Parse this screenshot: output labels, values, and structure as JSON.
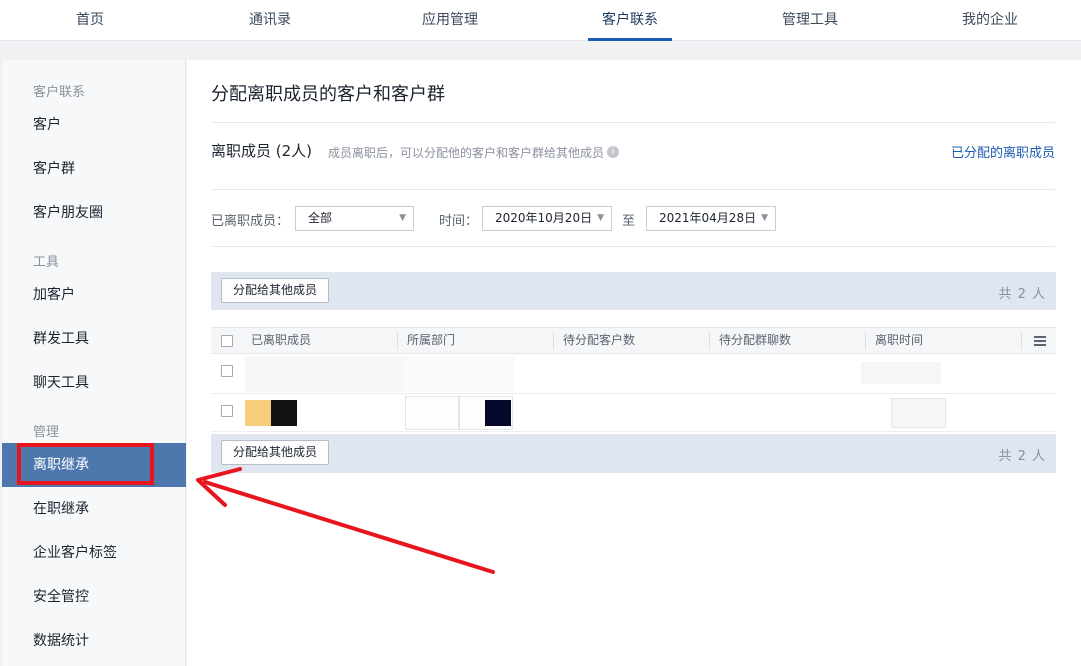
{
  "topnav": {
    "tabs": [
      {
        "label": "首页",
        "active": false
      },
      {
        "label": "通讯录",
        "active": false
      },
      {
        "label": "应用管理",
        "active": false
      },
      {
        "label": "客户联系",
        "active": true
      },
      {
        "label": "管理工具",
        "active": false
      },
      {
        "label": "我的企业",
        "active": false
      }
    ]
  },
  "sidebar": {
    "groups": [
      {
        "label": "客户联系",
        "items": [
          "客户",
          "客户群",
          "客户朋友圈"
        ]
      },
      {
        "label": "工具",
        "items": [
          "加客户",
          "群发工具",
          "聊天工具"
        ]
      },
      {
        "label": "管理",
        "items": [
          "离职继承",
          "在职继承",
          "企业客户标签",
          "安全管控",
          "数据统计"
        ]
      }
    ],
    "active_item": "离职继承"
  },
  "main": {
    "title": "分配离职成员的客户和客户群",
    "section_title": "离职成员 (2人)",
    "section_hint": "成员离职后，可以分配他的客户和客户群给其他成员",
    "assigned_link": "已分配的离职成员",
    "filter": {
      "member_label": "已离职成员：",
      "member_value": "全部",
      "time_label": "时间：",
      "start_date": "2020年10月20日",
      "to_label": "至",
      "end_date": "2021年04月28日"
    },
    "action_button": "分配给其他成员",
    "total_count": "共 2 人",
    "table": {
      "columns": [
        "已离职成员",
        "所属部门",
        "待分配客户数",
        "待分配群聊数",
        "离职时间"
      ]
    }
  },
  "colors": {
    "accent": "#1e5bb3",
    "sidebar_active": "#4d77ad",
    "annotation": "#e8141e"
  }
}
